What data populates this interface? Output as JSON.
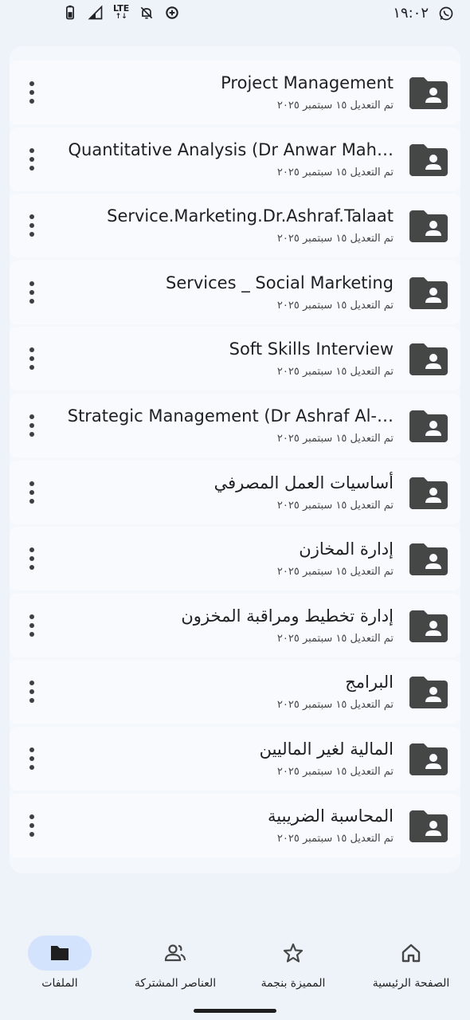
{
  "status_bar": {
    "time": "١٩:٠٢",
    "network": "LTE",
    "icons": [
      "whatsapp-icon",
      "data-saver-icon",
      "notifications-off-icon",
      "signal-icon",
      "battery-icon"
    ]
  },
  "files": [
    {
      "title": "Project Management",
      "modified": "تم التعديل ١٥ سبتمبر ٢٠٢٥"
    },
    {
      "title": "Quantitative Analysis (Dr Anwar Mah…",
      "modified": "تم التعديل ١٥ سبتمبر ٢٠٢٥"
    },
    {
      "title": "Service.Marketing.Dr.Ashraf.Talaat",
      "modified": "تم التعديل ١٥ سبتمبر ٢٠٢٥"
    },
    {
      "title": "Services _ Social Marketing",
      "modified": "تم التعديل ١٥ سبتمبر ٢٠٢٥"
    },
    {
      "title": "Soft Skills Interview",
      "modified": "تم التعديل ١٥ سبتمبر ٢٠٢٥"
    },
    {
      "title": "Strategic Management (Dr Ashraf Al-…",
      "modified": "تم التعديل ١٥ سبتمبر ٢٠٢٥"
    },
    {
      "title": "أساسيات العمل المصرفي",
      "modified": "تم التعديل ١٥ سبتمبر ٢٠٢٥"
    },
    {
      "title": "إدارة المخازن",
      "modified": "تم التعديل ١٥ سبتمبر ٢٠٢٥"
    },
    {
      "title": "إدارة تخطيط ومراقبة المخزون",
      "modified": "تم التعديل ١٥ سبتمبر ٢٠٢٥"
    },
    {
      "title": "البرامج",
      "modified": "تم التعديل ١٥ سبتمبر ٢٠٢٥"
    },
    {
      "title": "المالية لغير الماليين",
      "modified": "تم التعديل ١٥ سبتمبر ٢٠٢٥"
    },
    {
      "title": "المحاسبة الضريبية",
      "modified": "تم التعديل ١٥ سبتمبر ٢٠٢٥"
    }
  ],
  "nav": {
    "home": "الصفحة الرئيسية",
    "starred": "المميزة بنجمة",
    "shared": "العناصر المشتركة",
    "files": "الملفات",
    "active": "files"
  },
  "colors": {
    "background": "#eef2f9",
    "folder": "#444746",
    "active_pill": "#d3e3fd"
  }
}
